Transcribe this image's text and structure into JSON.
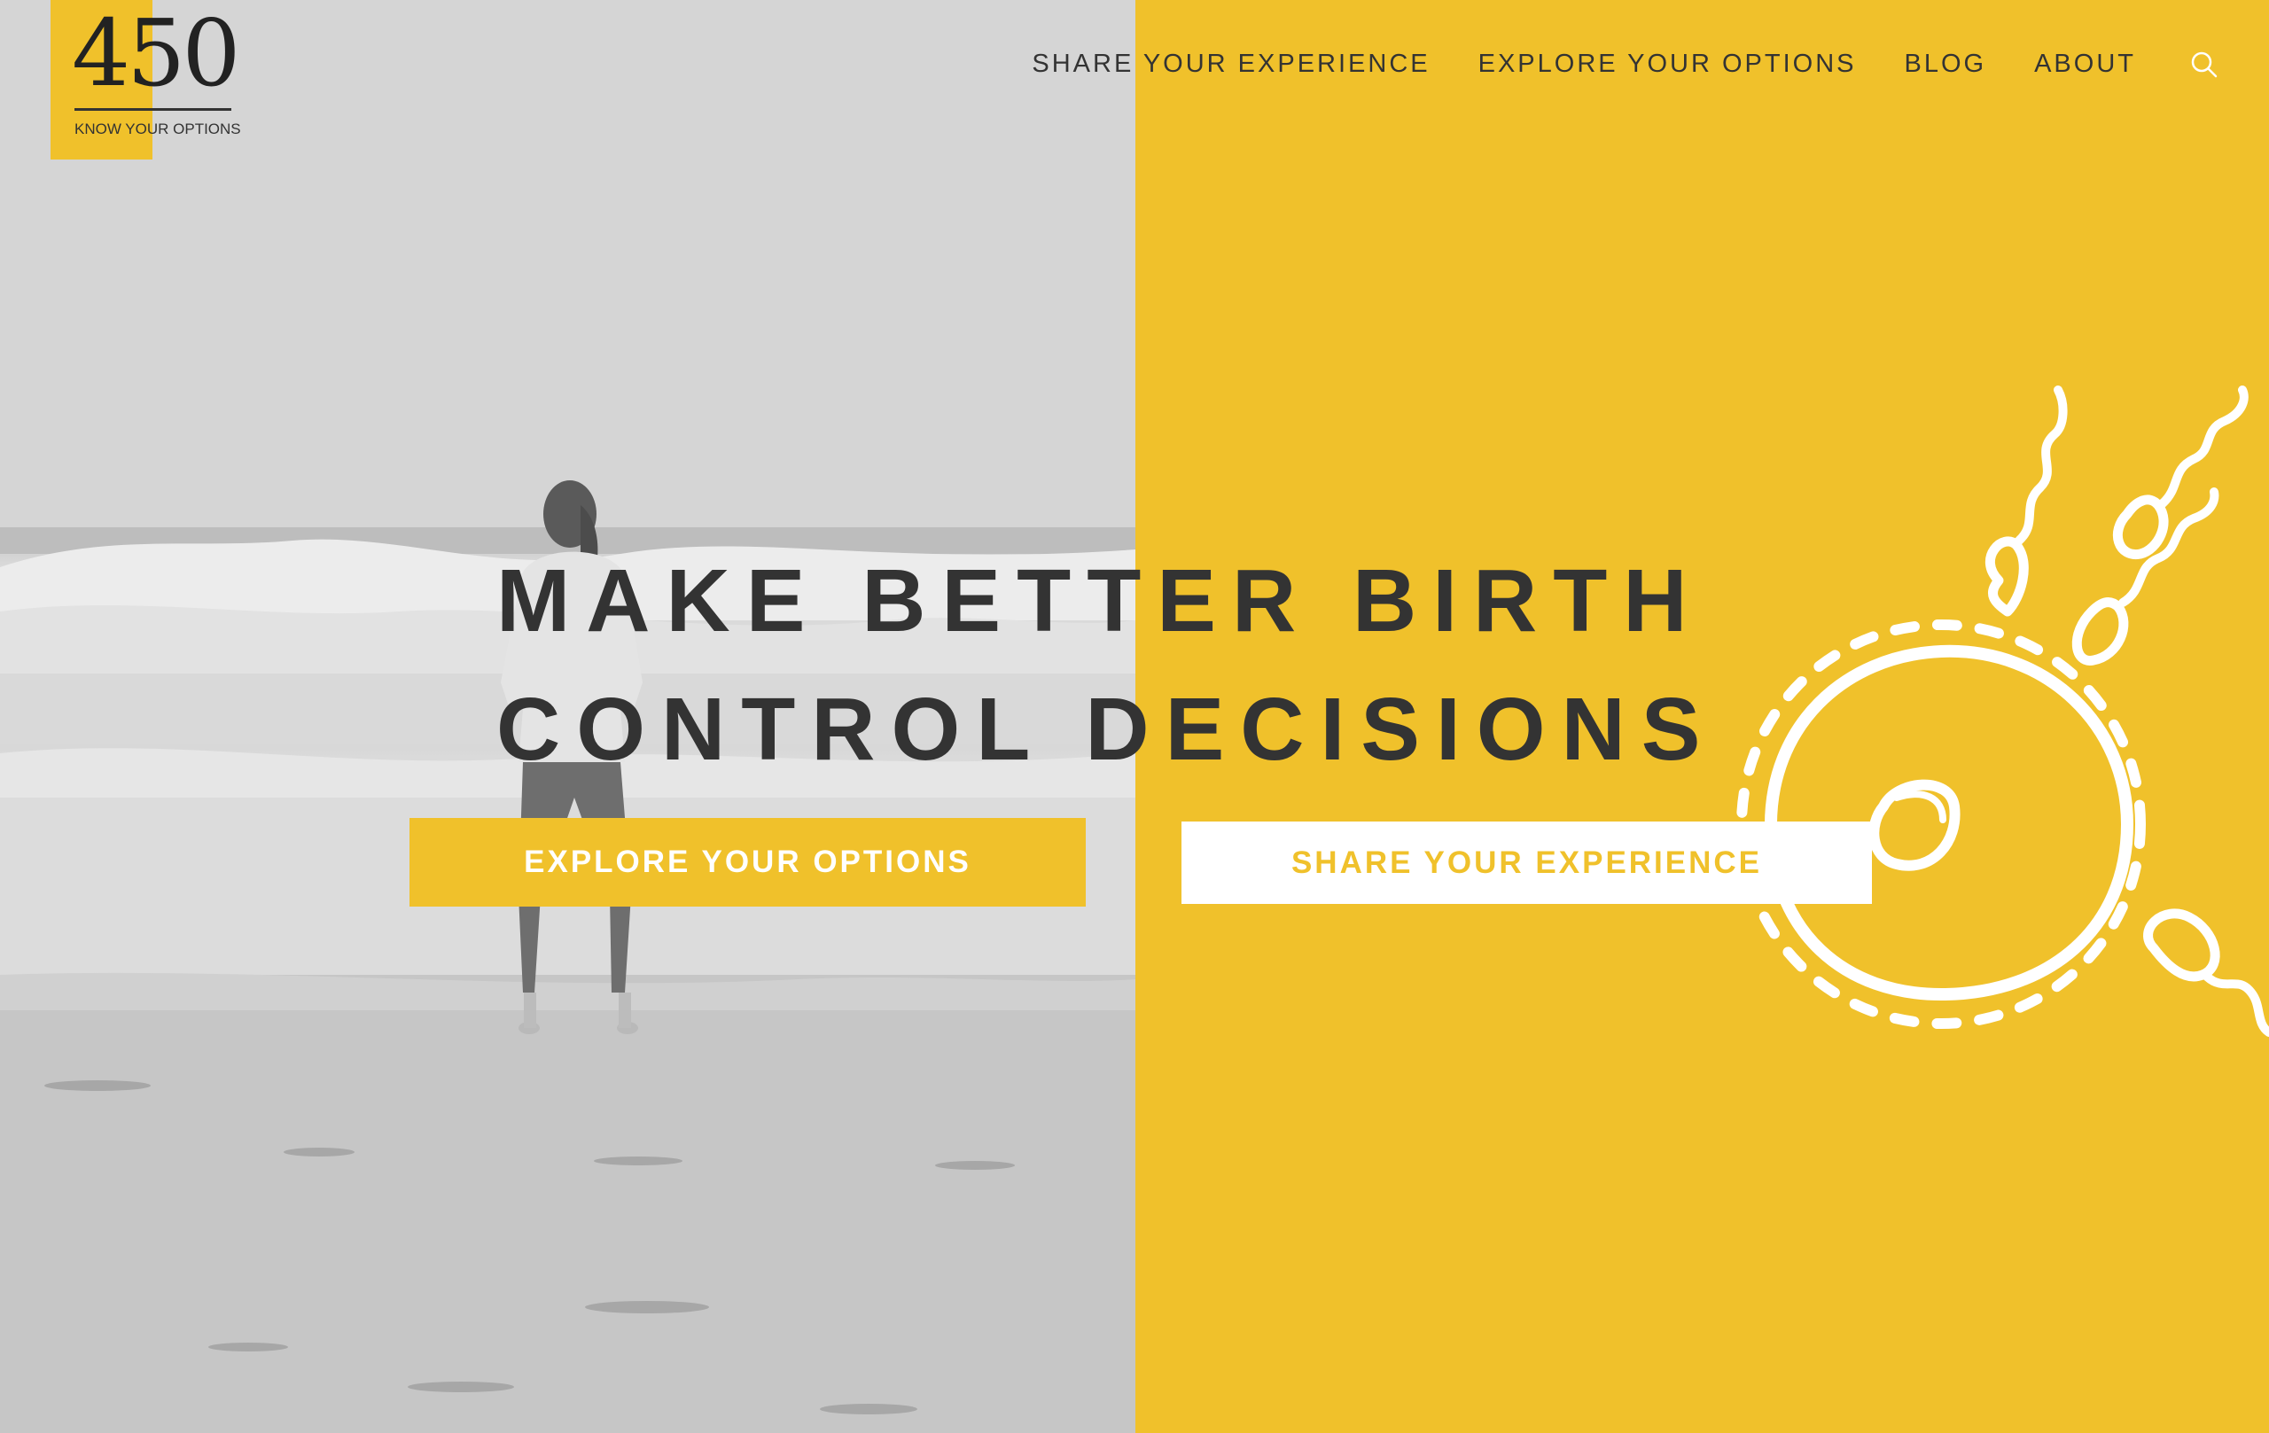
{
  "logo": {
    "number": "450",
    "tagline": "KNOW YOUR OPTIONS"
  },
  "nav": {
    "items": [
      "SHARE YOUR EXPERIENCE",
      "EXPLORE YOUR OPTIONS",
      "BLOG",
      "ABOUT"
    ],
    "search_icon": "search-icon"
  },
  "hero": {
    "headline_line1": "MAKE BETTER BIRTH",
    "headline_line2": "CONTROL DECISIONS",
    "primary_button": "EXPLORE YOUR OPTIONS",
    "secondary_button": "SHARE YOUR EXPERIENCE"
  },
  "colors": {
    "accent_yellow": "#f0c12b",
    "text_dark": "#333333",
    "white": "#ffffff"
  }
}
